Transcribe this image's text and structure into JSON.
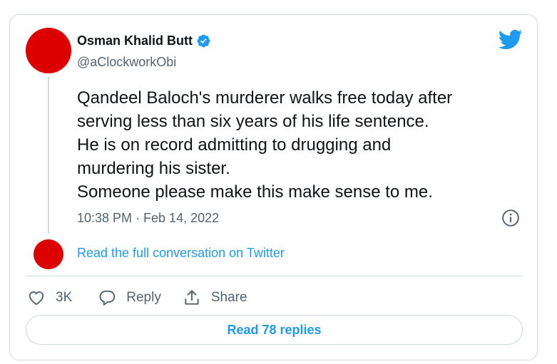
{
  "author": {
    "display_name": "Osman Khalid Butt",
    "handle": "@aClockworkObi",
    "verified": true,
    "avatar_color": "#dd0000"
  },
  "tweet": {
    "lines": [
      "Qandeel Baloch's murderer walks free today after",
      "serving less than six years of his life sentence.",
      "He is on record admitting to drugging and",
      "murdering his sister.",
      "Someone please make this make sense to me."
    ],
    "timestamp": "10:38 PM · Feb 14, 2022"
  },
  "conversation_link": "Read the full conversation on Twitter",
  "actions": {
    "like_count": "3K",
    "reply_label": "Reply",
    "share_label": "Share"
  },
  "read_replies_label": "Read 78 replies",
  "icons": {
    "brand": "twitter-bird-icon",
    "verified": "verified-badge-icon",
    "info": "info-icon",
    "like": "heart-icon",
    "reply": "speech-bubble-icon",
    "share": "share-upload-icon"
  },
  "colors": {
    "accent": "#1d9bf0",
    "text": "#0f1419",
    "secondary": "#536471",
    "border": "#cfd9de"
  }
}
